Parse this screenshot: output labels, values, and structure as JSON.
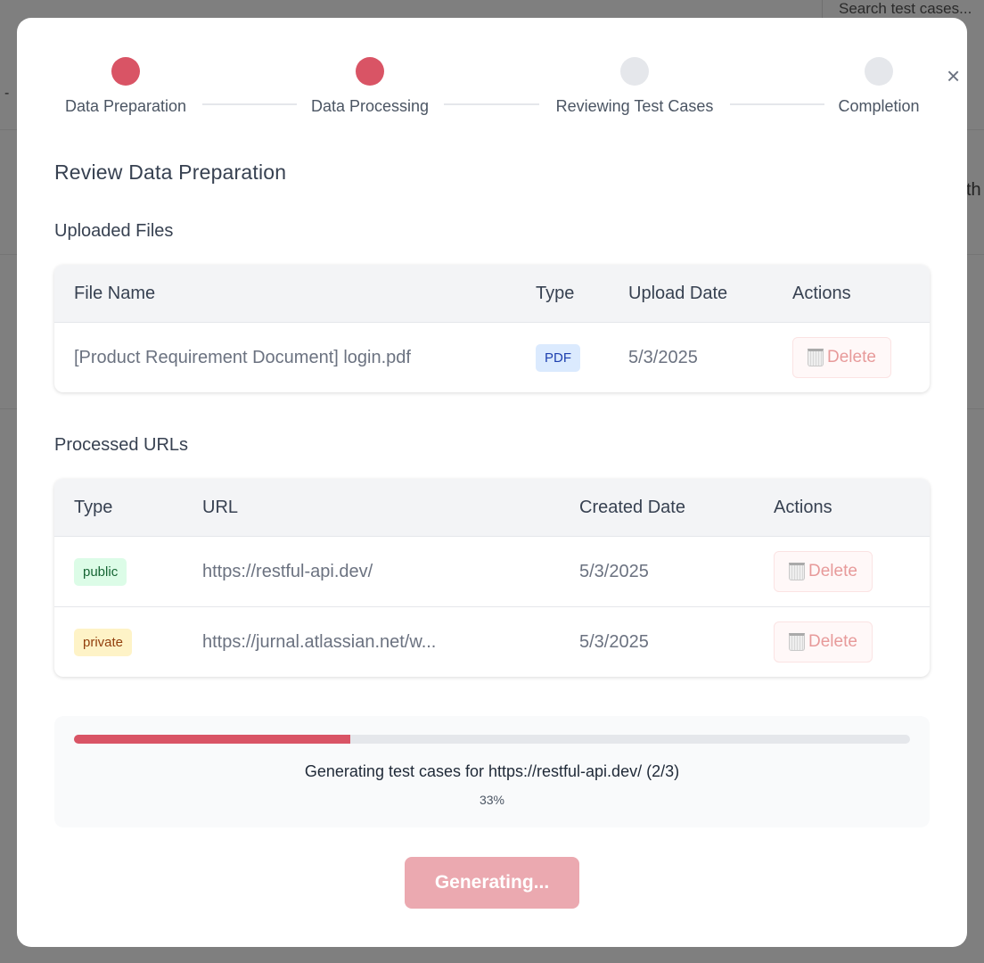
{
  "background": {
    "search_placeholder": "Search test cases...",
    "dash": "-",
    "fragment": "th"
  },
  "modal": {
    "close_icon": "×",
    "steps": [
      {
        "label": "Data Preparation",
        "active": true
      },
      {
        "label": "Data Processing",
        "active": true
      },
      {
        "label": "Reviewing Test Cases",
        "active": false
      },
      {
        "label": "Completion",
        "active": false
      }
    ],
    "title": "Review Data Preparation",
    "uploaded": {
      "title": "Uploaded Files",
      "headers": [
        "File Name",
        "Type",
        "Upload Date",
        "Actions"
      ],
      "rows": [
        {
          "name": "[Product Requirement Document] login.pdf",
          "type": "PDF",
          "date": "5/3/2025",
          "action": "Delete"
        }
      ]
    },
    "processed": {
      "title": "Processed URLs",
      "headers": [
        "Type",
        "URL",
        "Created Date",
        "Actions"
      ],
      "rows": [
        {
          "type": "public",
          "url": "https://restful-api.dev/",
          "date": "5/3/2025",
          "action": "Delete"
        },
        {
          "type": "private",
          "url": "https://jurnal.atlassian.net/w...",
          "date": "5/3/2025",
          "action": "Delete"
        }
      ]
    },
    "progress": {
      "percent": 33,
      "text": "Generating test cases for https://restful-api.dev/ (2/3)",
      "label": "33%"
    },
    "button": "Generating...",
    "colors": {
      "accent": "#d95465",
      "inactive": "#e5e7eb"
    }
  }
}
